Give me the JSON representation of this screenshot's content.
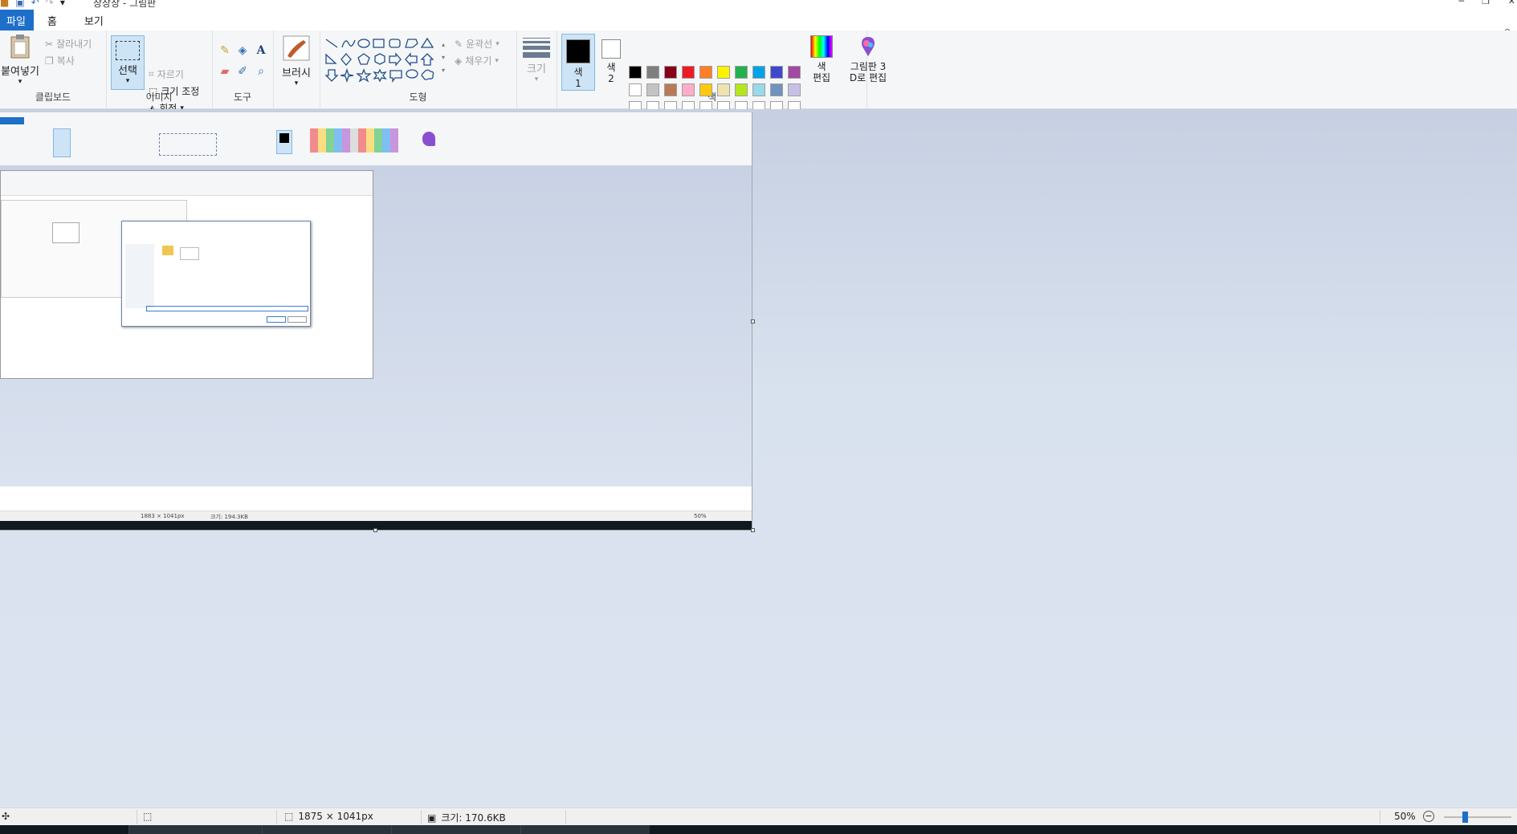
{
  "window": {
    "title": "장장장 - 그림판",
    "controls": [
      "─",
      "❐",
      "✕"
    ]
  },
  "tabs": [
    {
      "label": "파일",
      "active": true
    },
    {
      "label": "홈"
    },
    {
      "label": "보기"
    }
  ],
  "ribbon": {
    "clipboard": {
      "label": "클립보드",
      "paste": "붙여넣기",
      "cut": "잘라내기",
      "copy": "복사"
    },
    "image": {
      "label": "이미지",
      "select": "선택",
      "crop": "자르기",
      "resize": "크기 조정",
      "rotate": "회전"
    },
    "tools": {
      "label": "도구"
    },
    "brush": {
      "label": "브러시"
    },
    "shapes": {
      "label": "도형",
      "outline": "윤곽선",
      "fill": "채우기"
    },
    "size": {
      "label": "크기"
    },
    "colors": {
      "label": "색",
      "color1": "색\n1",
      "color1_a": "색",
      "color1_b": "1",
      "color2_a": "색",
      "color2_b": "2",
      "edit_a": "색",
      "edit_b": "편집",
      "paint3d_a": "그림판 3",
      "paint3d_b": "D로 편집",
      "palette_row1": [
        "#000000",
        "#7f7f7f",
        "#880015",
        "#ed1c24",
        "#ff7f27",
        "#fff200",
        "#22b14c",
        "#00a2e8",
        "#3f48cc",
        "#a349a4"
      ],
      "palette_row2": [
        "#ffffff",
        "#c3c3c3",
        "#b97a57",
        "#ffaec9",
        "#ffc90e",
        "#efe4b0",
        "#b5e61d",
        "#99d9ea",
        "#7092be",
        "#c8bfe7"
      ],
      "palette_row3": [
        "#ffffff",
        "#ffffff",
        "#ffffff",
        "#ffffff",
        "#ffffff",
        "#ffffff",
        "#ffffff",
        "#ffffff",
        "#ffffff",
        "#ffffff"
      ],
      "primary": "#000000",
      "secondary": "#ffffff"
    }
  },
  "inner_status": {
    "dims": "1883 × 1041px",
    "size": "크기: 194.3KB",
    "zoom": "50%"
  },
  "status": {
    "dims": "1875 × 1041px",
    "size": "크기: 170.6KB",
    "zoom": "50%",
    "zoom_level_percent": 50
  }
}
